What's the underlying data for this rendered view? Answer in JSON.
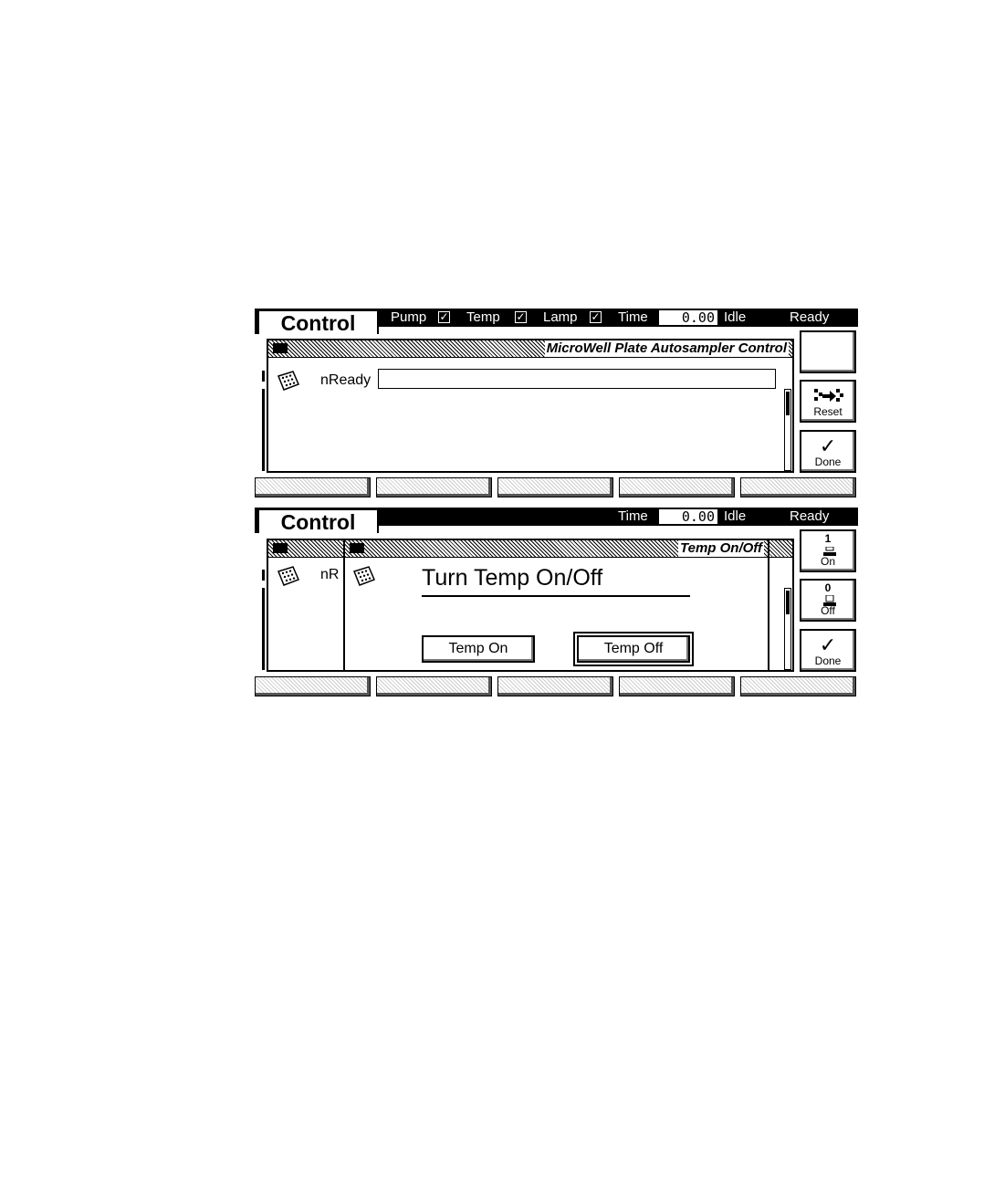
{
  "screen1": {
    "tab_title": "Control",
    "status": {
      "pump_label": "Pump",
      "pump_checked": "✓",
      "temp_label": "Temp",
      "temp_checked": "✓",
      "lamp_label": "Lamp",
      "lamp_checked": "✓",
      "time_label": "Time",
      "time_value": "0.00",
      "run_state": "Idle",
      "system_state": "Ready"
    },
    "window": {
      "title": "MicroWell Plate Autosampler Control",
      "field_label": "nReady",
      "field_value": ""
    },
    "softkeys": [
      {
        "label": ""
      },
      {
        "label": "Reset",
        "icon": "reset-icon"
      },
      {
        "label": "Done",
        "icon": "checkmark-icon",
        "glyph": "✓"
      }
    ]
  },
  "screen2": {
    "tab_title": "Control",
    "status": {
      "time_label": "Time",
      "time_value": "0.00",
      "run_state": "Idle",
      "system_state": "Ready"
    },
    "back_window": {
      "field_label_partial": "nR"
    },
    "dialog": {
      "title": "Temp On/Off",
      "heading": "Turn Temp On/Off",
      "button_on": "Temp On",
      "button_off": "Temp Off"
    },
    "softkeys": [
      {
        "num": "1",
        "label": "On",
        "icon": "on-switch-icon"
      },
      {
        "num": "0",
        "label": "Off",
        "icon": "off-switch-icon"
      },
      {
        "label": "Done",
        "icon": "checkmark-icon",
        "glyph": "✓"
      }
    ]
  },
  "colors": {
    "foreground": "#000000",
    "background": "#ffffff"
  }
}
